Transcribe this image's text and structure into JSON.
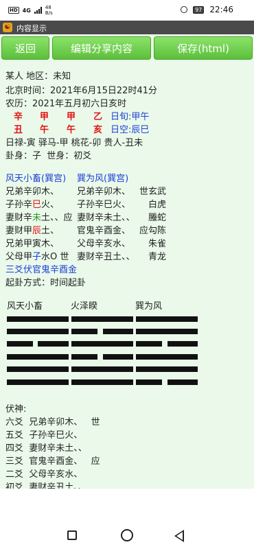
{
  "status": {
    "hd": "HD",
    "signal": "4G",
    "net_top": "48",
    "net_unit": "B/s",
    "battery": "97",
    "time": "22:46"
  },
  "titlebar": {
    "title": "内容显示",
    "logo": "☯"
  },
  "toolbar": {
    "back": "返回",
    "edit": "编辑分享内容",
    "save": "保存(html)"
  },
  "info": {
    "person": "某人 地区：未知",
    "beijing": "北京时间：2021年6月15日22时41分",
    "lunar": "农历：2021年五月初六日亥时",
    "gan": [
      "辛",
      "甲",
      "甲",
      "乙"
    ],
    "zhi": [
      "丑",
      "午",
      "午",
      "亥"
    ],
    "xun": "日旬:甲午",
    "kong": "日空:辰巳",
    "shen": "日禄-寅 驿马-甲 桃花-卯 贵人-丑未",
    "guashen": "卦身：子  世身：初爻"
  },
  "gua": {
    "name1": "风天小畜(巽宫)",
    "name2": "巽为风(巽宫)",
    "rows": [
      {
        "a": "兄弟辛卯木、",
        "b": "兄弟辛卯木、",
        "c": "世玄武"
      },
      {
        "a_pre": "子孙辛",
        "a_hi": "巳",
        "a_post": "火、",
        "b": "子孙辛巳火、",
        "c": "白虎"
      },
      {
        "a_pre": "妻财辛",
        "a_hi": "未",
        "a_post": "土、、应",
        "b": "妻财辛未土、、",
        "c": "螣蛇"
      },
      {
        "a_pre": "妻财甲",
        "a_hi": "辰",
        "a_post": "土、",
        "b": "官鬼辛酉金、",
        "c": "应勾陈"
      },
      {
        "a": "兄弟甲寅木、",
        "b": "父母辛亥水、",
        "c": "朱雀"
      },
      {
        "a_pre": "父母甲",
        "a_hi": "子",
        "a_post": "水O 世",
        "b": "妻财辛丑土、、",
        "c": "青龙"
      }
    ],
    "fu": "三爻伏官鬼辛酉金",
    "method": "起卦方式：时间起卦"
  },
  "hexagrams": {
    "h1": "风天小畜",
    "h2": "火泽睽",
    "h3": "巽为风"
  },
  "fushen": {
    "title": "伏神:",
    "rows": [
      "六爻  兄弟辛卯木、   世",
      "五爻  子孙辛巳火、",
      "四爻  妻财辛未土、、",
      "三爻  官鬼辛酉金、   应",
      "二爻  父母辛亥水、",
      "初爻  妻财辛丑土、、"
    ]
  },
  "colors": {
    "accent": "#e21212",
    "link": "#1a3fd6",
    "bg": "#eaf9ea",
    "button": "#6fcf4c"
  }
}
